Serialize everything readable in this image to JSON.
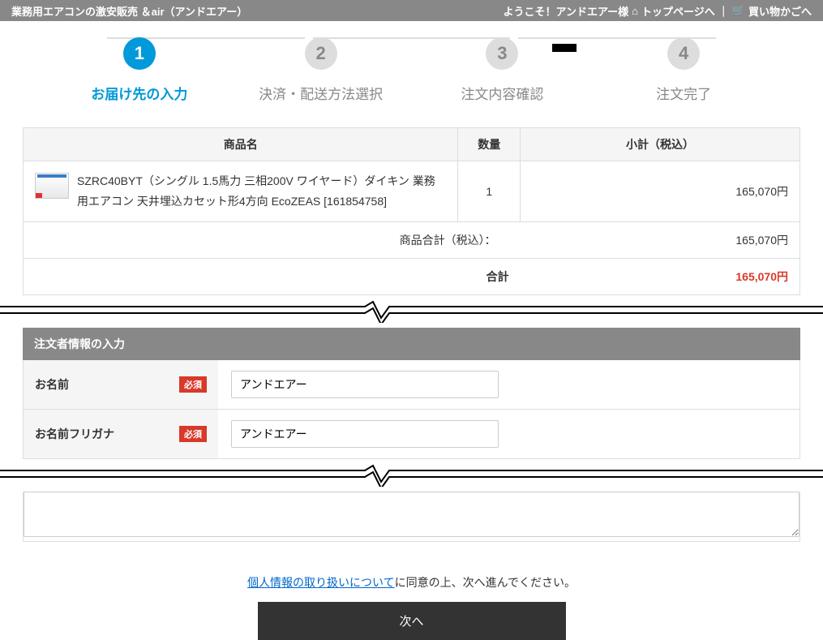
{
  "topbar": {
    "site_title": "業務用エアコンの激安販売 ＆air（アンドエアー）",
    "welcome": "ようこそ！アンドエアー様",
    "home_icon": "⌂",
    "to_top": "トップページへ",
    "sep": "｜",
    "cart_icon": "🛒",
    "to_cart": "買い物かごへ"
  },
  "steps": {
    "s1": {
      "num": "1",
      "label": "お届け先の入力"
    },
    "s2": {
      "num": "2",
      "label": "決済・配送方法選択"
    },
    "s3": {
      "num": "3",
      "label": "注文内容確認"
    },
    "s4": {
      "num": "4",
      "label": "注文完了"
    }
  },
  "table_headers": {
    "name": "商品名",
    "qty": "数量",
    "subtotal": "小計（税込）"
  },
  "item": {
    "name": "SZRC40BYT（シングル 1.5馬力 三相200V ワイヤード）ダイキン 業務用エアコン 天井埋込カセット形4方向 EcoZEAS [161854758]",
    "qty": "1",
    "subtotal": "165,070円"
  },
  "summary": {
    "goods_label": "商品合計（税込）：",
    "goods_val": "165,070円",
    "total_label": "合計",
    "total_val": "165,070円"
  },
  "form": {
    "section_title": "注文者情報の入力",
    "required": "必須",
    "name_label": "お名前",
    "name_value": "アンドエアー",
    "kana_label": "お名前フリガナ",
    "kana_value": "アンドエアー"
  },
  "consent": {
    "link": "個人情報の取り扱いについて",
    "text": "に同意の上、次へ進んでください。"
  },
  "next_button": "次へ"
}
